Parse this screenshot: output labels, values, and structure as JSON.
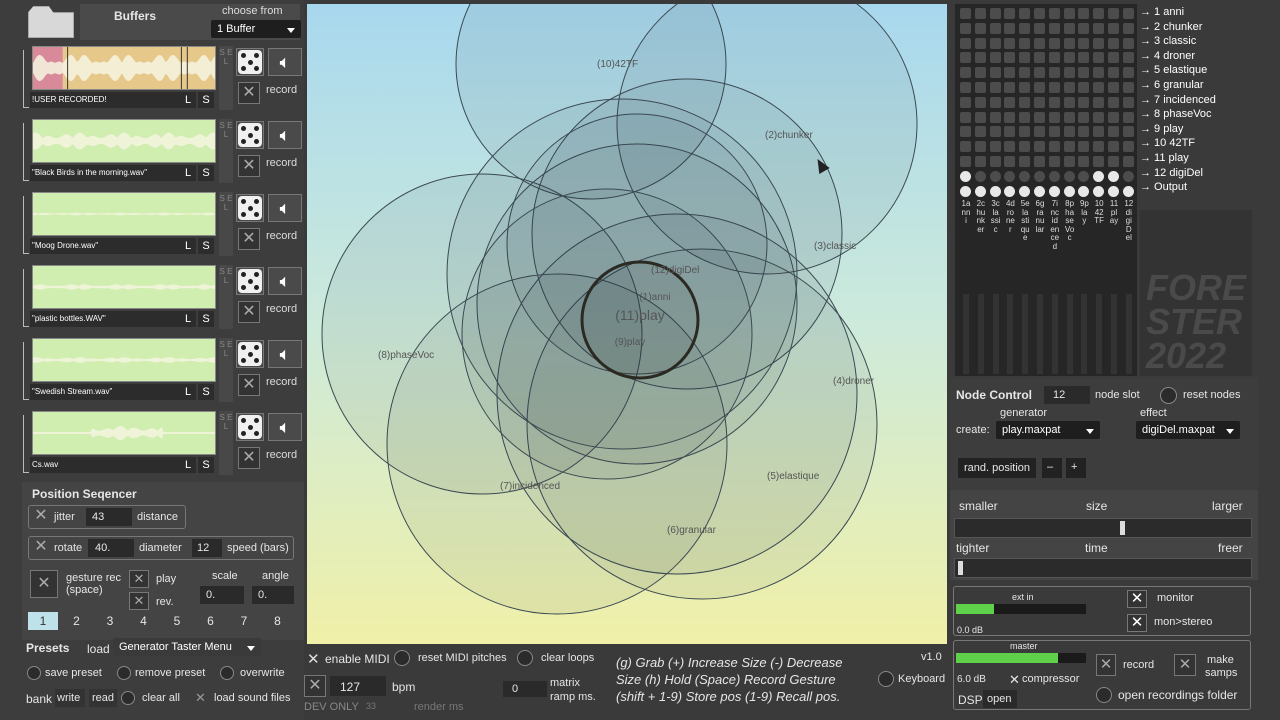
{
  "left": {
    "buffers_title": "Buffers",
    "choose_from": "choose from",
    "buffer_select": "1 Buffer",
    "buffers": [
      {
        "name": "!USER RECORDED!",
        "L": "L",
        "S": "S",
        "sel": "S E L",
        "record": "record"
      },
      {
        "name": "\"Black Birds in the morning.wav\"",
        "L": "L",
        "S": "S",
        "sel": "S E L",
        "record": "record"
      },
      {
        "name": "\"Moog Drone.wav\"",
        "L": "L",
        "S": "S",
        "sel": "S E L",
        "record": "record"
      },
      {
        "name": "\"plastic bottles.WAV\"",
        "L": "L",
        "S": "S",
        "sel": "S E L",
        "record": "record"
      },
      {
        "name": "\"Swedish Stream.wav\"",
        "L": "L",
        "S": "S",
        "sel": "S E L",
        "record": "record"
      },
      {
        "name": "Cs.wav",
        "L": "L",
        "S": "S",
        "sel": "S E L",
        "record": "record"
      }
    ],
    "pos_seq": {
      "title": "Position Seqencer",
      "jitter": "jitter",
      "jitter_val": "43",
      "distance": "distance",
      "rotate": "rotate",
      "rotate_val": "40.",
      "diameter": "diameter",
      "diameter_val": "12",
      "speed": "speed (bars)",
      "gesture": "gesture rec",
      "gesture2": "(space)",
      "play": "play",
      "rev": "rev.",
      "scale": "scale",
      "scale_val": "0.",
      "angle": "angle",
      "angle_val": "0.",
      "steps": [
        "1",
        "2",
        "3",
        "4",
        "5",
        "6",
        "7",
        "8"
      ]
    },
    "presets": {
      "title": "Presets",
      "load": "load",
      "menu": "Generator Taster Menu",
      "save": "save preset",
      "remove": "remove preset",
      "overwrite": "overwrite",
      "bank": "bank",
      "write": "write",
      "read": "read",
      "clear_all": "clear all",
      "load_sound": "load sound files"
    }
  },
  "canvas": {
    "nodes": [
      {
        "label": "(10)42TF"
      },
      {
        "label": "(2)chunker"
      },
      {
        "label": "(3)classic"
      },
      {
        "label": "(12)digiDel"
      },
      {
        "label": "(1)anni"
      },
      {
        "label": "(11)play"
      },
      {
        "label": "(9)play"
      },
      {
        "label": "(8)phaseVoc"
      },
      {
        "label": "(4)droner"
      },
      {
        "label": "(7)incidenced"
      },
      {
        "label": "(5)elastique"
      },
      {
        "label": "(6)granular"
      }
    ]
  },
  "bottom": {
    "enable_midi": "enable MIDI",
    "reset_midi": "reset MIDI pitches",
    "clear_loops": "clear loops",
    "bpm_val": "127",
    "bpm": "bpm",
    "matrix_val": "0",
    "matrix_ramp": "matrix",
    "matrix_ramp2": "ramp ms.",
    "dev_only": "DEV ONLY",
    "dev_val": "33",
    "render": "render ms",
    "help1": "(g) Grab   (+) Increase Size  (-) Decrease",
    "help2": "Size  (h) Hold  (Space) Record Gesture",
    "help3": "(shift + 1-9) Store pos   (1-9) Recall pos.",
    "version": "v1.0",
    "keyboard": "Keyboard"
  },
  "right": {
    "outputs": [
      "1 anni",
      "2 chunker",
      "3 classic",
      "4 droner",
      "5 elastique",
      "6 granular",
      "7 incidenced",
      "8 phaseVoc",
      "9 play",
      "10 42TF",
      "11 play",
      "12 digiDel",
      "Output"
    ],
    "columns": [
      "1anni",
      "2chunker",
      "3classic",
      "4droner",
      "5elastique",
      "6granular",
      "7incidenced",
      "8phaseVoc",
      "9play",
      "1042TF",
      "11play",
      "12digiDel"
    ],
    "logo1": "FORE",
    "logo2": "STER",
    "logo3": "2022",
    "node_control": "Node Control",
    "slot_val": "12",
    "node_slot": "node slot",
    "reset_nodes": "reset nodes",
    "generator": "generator",
    "effect": "effect",
    "create": "create:",
    "gen_val": "play.maxpat",
    "eff_val": "digiDel.maxpat",
    "rand_pos": "rand. position",
    "minus": "–",
    "plus": "+",
    "smaller": "smaller",
    "size": "size",
    "larger": "larger",
    "size_level": 0.57,
    "tighter": "tighter",
    "time": "time",
    "freer": "freer",
    "time_level": 0.01,
    "ext_in": "ext in",
    "ext_db": "0.0 dB",
    "monitor": "monitor",
    "mon_stereo": "mon>stereo",
    "master": "master",
    "master_db": "6.0 dB",
    "compressor": "compressor",
    "record": "record",
    "make_samps": "make",
    "make_samps2": "samps",
    "dsp": "DSP",
    "open": "open",
    "open_rec": "open recordings folder"
  }
}
